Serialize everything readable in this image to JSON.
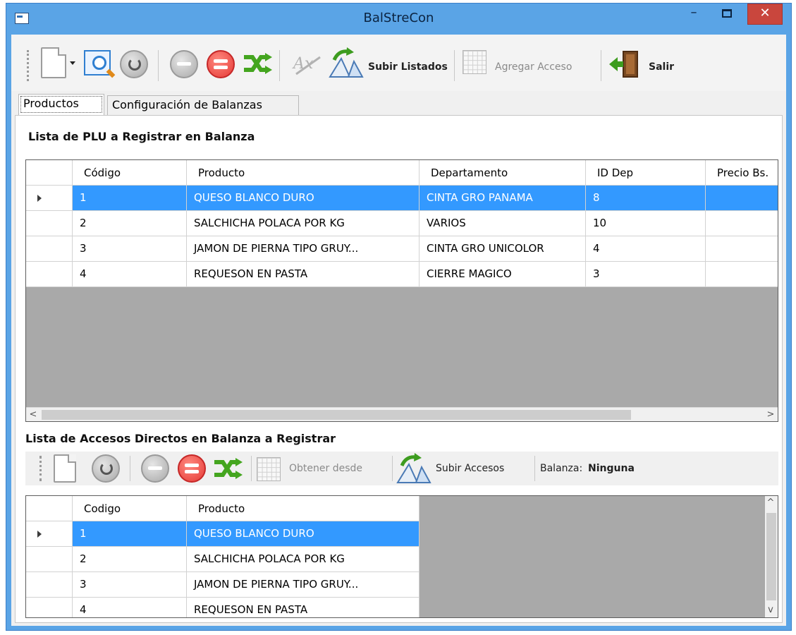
{
  "window": {
    "title": "BalStreCon",
    "minimize_glyph": "–",
    "close_glyph": "✕"
  },
  "toolbar": {
    "subir_listados": "Subir Listados",
    "agregar_acceso": "Agregar Acceso",
    "salir": "Salir"
  },
  "tabs": [
    "Productos",
    "Configuración de Balanzas"
  ],
  "plu_section": {
    "title": "Lista de PLU a Registrar en Balanza",
    "columns": [
      "Código",
      "Producto",
      "Departamento",
      "ID Dep",
      "Precio Bs."
    ],
    "rows": [
      [
        "1",
        "QUESO BLANCO DURO",
        "CINTA GRO PANAMA",
        "8",
        ""
      ],
      [
        "2",
        "SALCHICHA POLACA POR KG",
        "VARIOS",
        "10",
        ""
      ],
      [
        "3",
        "JAMON DE PIERNA TIPO GRUY...",
        "CINTA GRO UNICOLOR",
        "4",
        ""
      ],
      [
        "4",
        "REQUESON EN PASTA",
        "CIERRE MAGICO",
        "3",
        ""
      ]
    ],
    "scroll_left": "<",
    "scroll_right": ">"
  },
  "accesos_section": {
    "title": "Lista de Accesos Directos en Balanza a Registrar",
    "obtener_desde": "Obtener desde",
    "subir_accesos": "Subir Accesos",
    "balanza_label": "Balanza:",
    "balanza_value": "Ninguna",
    "columns": [
      "Codigo",
      "Producto"
    ],
    "rows": [
      [
        "1",
        "QUESO BLANCO DURO"
      ],
      [
        "2",
        "SALCHICHA POLACA POR KG"
      ],
      [
        "3",
        "JAMON DE PIERNA TIPO GRUY..."
      ],
      [
        "4",
        "REQUESON EN PASTA"
      ]
    ],
    "scroll_up": "^",
    "scroll_down": "v"
  },
  "colors": {
    "title_bar": "#5aa4e6",
    "close_button": "#c9463d",
    "selection": "#3399ff",
    "grid_empty": "#a9a9a9"
  }
}
